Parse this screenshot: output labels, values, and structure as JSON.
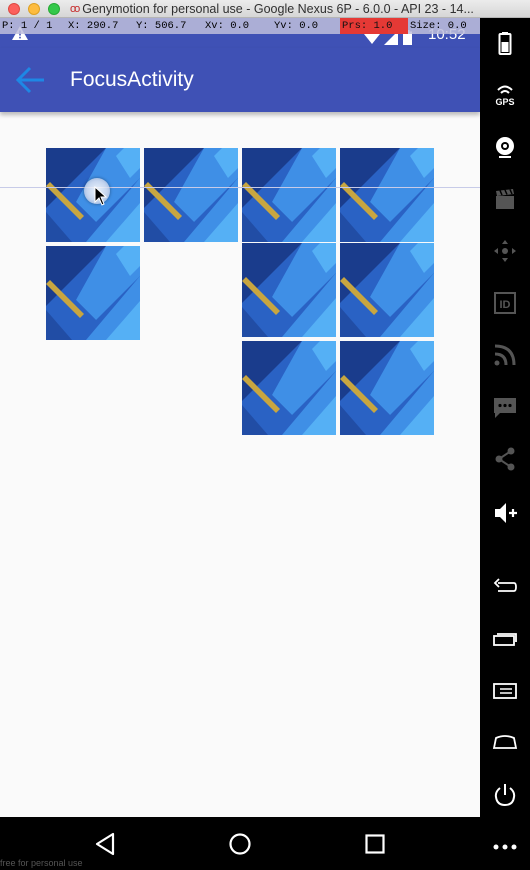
{
  "window": {
    "title": "Genymotion for personal use - Google Nexus 6P - 6.0.0 - API 23 - 14...",
    "logo_text": "oo"
  },
  "pointer_location": {
    "pointer": "P: 1 / 1",
    "x": "X: 290.7",
    "y": "Y: 506.7",
    "xv": "Xv: 0.0",
    "yv": "Yv: 0.0",
    "prs": "Prs: 1.0",
    "size": "Size: 0.0"
  },
  "status_bar": {
    "time": "10:52",
    "warning_icon": "warning-icon",
    "color": "#3f51b5"
  },
  "app_bar": {
    "title": "FocusActivity",
    "back_icon": "arrow-back-icon",
    "color": "#3f51b5",
    "accent": "#1e88e5"
  },
  "grid": {
    "tiles": [
      {
        "id": "r1c1",
        "label": ""
      },
      {
        "id": "r1c2",
        "label": ""
      },
      {
        "id": "r1c3",
        "label": ""
      },
      {
        "id": "r1c4",
        "label": ""
      },
      {
        "id": "r2c1",
        "label": ""
      },
      {
        "id": "r2c3",
        "label": ""
      },
      {
        "id": "r2c4",
        "label": ""
      },
      {
        "id": "r3c3",
        "label": ""
      },
      {
        "id": "r3c4",
        "label": ""
      }
    ],
    "image_colors": {
      "dark": "#1a3c8c",
      "mid": "#2a62c4",
      "light": "#3f8fe6",
      "bright": "#55b0f5",
      "stripe": "#c8a640"
    }
  },
  "nav_bar": {
    "back_icon": "nav-back-icon",
    "home_icon": "nav-home-icon",
    "recents_icon": "nav-recents-icon"
  },
  "watermark": "free for personal use",
  "toolbar": {
    "items": [
      "battery-icon",
      "gps-icon",
      "camera-icon",
      "video-capture-icon",
      "dpad-icon",
      "device-id-icon",
      "network-icon",
      "sms-icon",
      "share-icon",
      "volume-up-icon",
      "back-icon",
      "recent-apps-icon",
      "menu-icon",
      "home-icon",
      "power-icon",
      "more-icon"
    ]
  }
}
